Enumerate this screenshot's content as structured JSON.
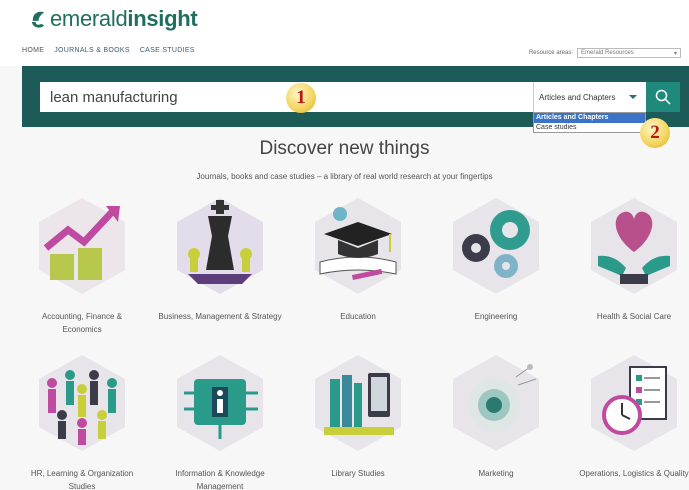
{
  "brand": {
    "name_part1": "emerald",
    "name_part2": "insight"
  },
  "nav": {
    "items": [
      {
        "label": "HOME",
        "active": true
      },
      {
        "label": "JOURNALS & BOOKS",
        "active": false
      },
      {
        "label": "CASE STUDIES",
        "active": false
      }
    ]
  },
  "resource": {
    "label": "Resource areas:",
    "selected": "Emerald Resources"
  },
  "search": {
    "value": "lean manufacturing",
    "scope_selected": "Articles and Chapters",
    "scope_options": [
      "Articles and Chapters",
      "Case studies"
    ]
  },
  "annotations": [
    "1",
    "2"
  ],
  "discover": {
    "heading": "Discover new things",
    "subheading": "Journals, books and case studies – a library of real world research at your fingertips"
  },
  "categories": [
    {
      "label": "Accounting, Finance &\nEconomics",
      "icon": "finance-chart-icon"
    },
    {
      "label": "Business, Management & Strategy",
      "icon": "chess-king-icon"
    },
    {
      "label": "Education",
      "icon": "graduation-cap-icon"
    },
    {
      "label": "Engineering",
      "icon": "gears-icon"
    },
    {
      "label": "Health & Social Care",
      "icon": "heart-hands-icon"
    },
    {
      "label": "HR, Learning & Organization\nStudies",
      "icon": "people-circle-icon"
    },
    {
      "label": "Information & Knowledge\nManagement",
      "icon": "info-circuit-icon"
    },
    {
      "label": "Library Studies",
      "icon": "books-icon"
    },
    {
      "label": "Marketing",
      "icon": "dandelion-icon"
    },
    {
      "label": "Operations, Logistics & Quality",
      "icon": "clock-checklist-icon"
    }
  ],
  "colors": {
    "brand_green": "#1f6e5f",
    "band": "#1c5b58",
    "search_button": "#1f8a7c",
    "badge_text": "#b8160f"
  }
}
